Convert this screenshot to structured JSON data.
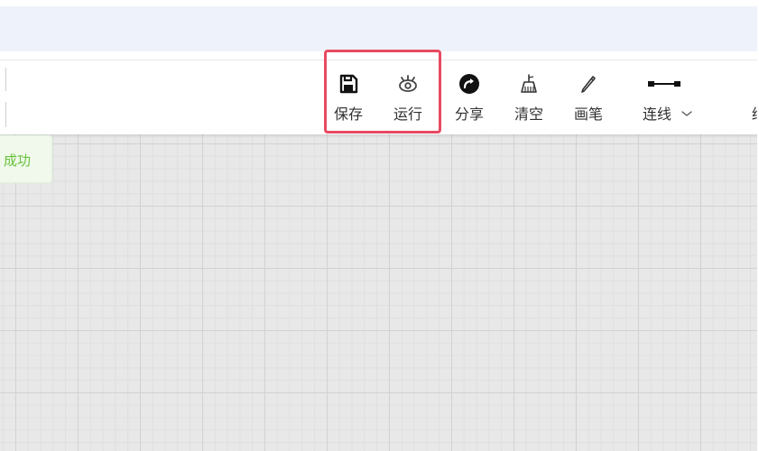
{
  "toolbar": {
    "items": [
      {
        "key": "save",
        "label": "保存",
        "icon": "save-icon"
      },
      {
        "key": "run",
        "label": "运行",
        "icon": "eye-icon"
      },
      {
        "key": "share",
        "label": "分享",
        "icon": "share-icon"
      },
      {
        "key": "clear",
        "label": "清空",
        "icon": "broom-icon"
      },
      {
        "key": "pen",
        "label": "画笔",
        "icon": "pencil-icon"
      },
      {
        "key": "connect",
        "label": "连线",
        "icon": "connector-line-icon"
      }
    ],
    "connect_dropdown_icon": "chevron-down-icon",
    "overflow_partial_label": "绯"
  },
  "toast": {
    "text": "成功",
    "color": "#67c23a"
  },
  "highlight": {
    "color": "#e84a61",
    "covers": [
      "save",
      "run"
    ]
  },
  "colors": {
    "top_band": "#eef2fb",
    "canvas": "#e8e8e8",
    "grid_major": "#d2d2d2",
    "grid_minor": "#dfdfdf"
  }
}
